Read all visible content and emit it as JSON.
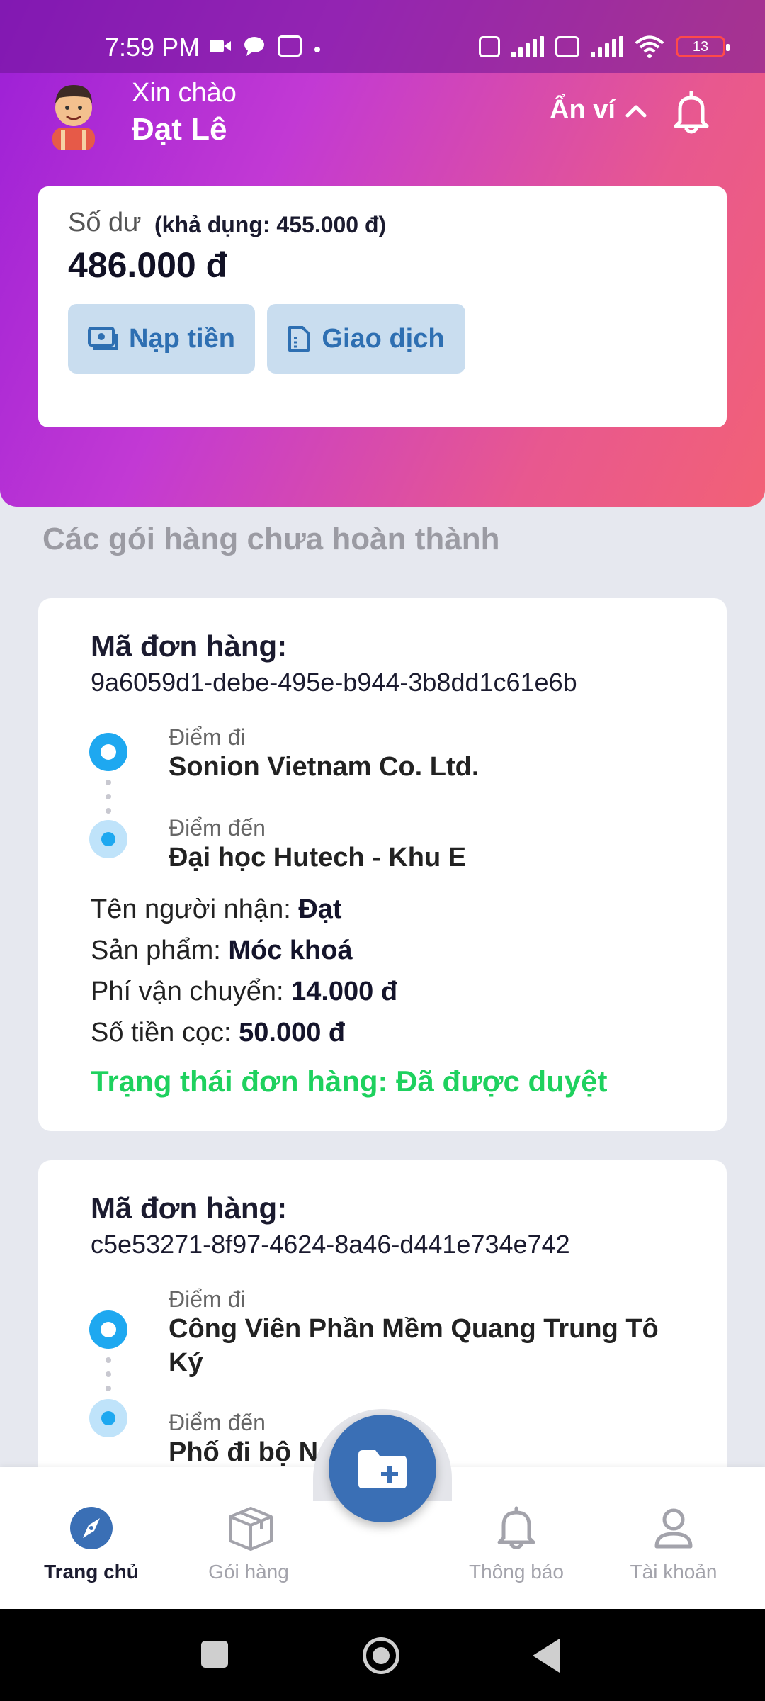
{
  "status_bar": {
    "time": "7:59 PM",
    "battery": "13",
    "icons": [
      "video-icon",
      "chat-icon",
      "screen-icon",
      "nfc-icon",
      "signal-icon",
      "volte-icon",
      "signal-icon",
      "wifi-icon",
      "battery-icon"
    ]
  },
  "header": {
    "greeting": "Xin chào",
    "username": "Đạt Lê",
    "hide_wallet_label": "Ẩn ví",
    "gradient_colors": [
      "#9b1fd6",
      "#c239d4",
      "#e8588f",
      "#f26176"
    ]
  },
  "wallet": {
    "balance_label": "Số dư",
    "available_label": "(khả dụng: 455.000 đ)",
    "balance_amount": "486.000 đ",
    "topup_label": "Nạp tiền",
    "transactions_label": "Giao dịch",
    "button_color": "#c9ddef",
    "button_text_color": "#2e6fb2"
  },
  "orders_section": {
    "title": "Các gói hàng chưa hoàn thành",
    "orders": [
      {
        "id_label": "Mã đơn hàng:",
        "id": "9a6059d1-debe-495e-b944-3b8dd1c61e6b",
        "from_label": "Điểm đi",
        "from": "Sonion Vietnam Co. Ltd.",
        "to_label": "Điểm đến",
        "to": "Đại học Hutech - Khu E",
        "receiver_label": "Tên người nhận:",
        "receiver": "Đạt",
        "product_label": "Sản phẩm:",
        "product": "Móc khoá",
        "shipping_label": "Phí vận chuyển:",
        "shipping": "14.000 đ",
        "deposit_label": "Số tiền cọc:",
        "deposit": "50.000 đ",
        "status": "Trạng thái đơn hàng: Đã được duyệt",
        "status_color": "#1ed15e"
      },
      {
        "id_label": "Mã đơn hàng:",
        "id": "c5e53271-8f97-4624-8a46-d441e734e742",
        "from_label": "Điểm đi",
        "from": "Công Viên Phần Mềm Quang Trung Tô Ký",
        "to_label": "Điểm đến",
        "to": "Phố đi bộ Ng",
        "to_tail": "ệ"
      }
    ]
  },
  "bottom_nav": {
    "items": [
      {
        "label": "Trang chủ",
        "icon": "compass-icon",
        "active": true
      },
      {
        "label": "Gói hàng",
        "icon": "package-icon",
        "active": false
      },
      {
        "label": "Thông báo",
        "icon": "bell-icon",
        "active": false
      },
      {
        "label": "Tài khoản",
        "icon": "user-icon",
        "active": false
      }
    ],
    "fab_icon": "folder-add-icon",
    "fab_color": "#3a6fb5"
  },
  "system_nav": {
    "icons": [
      "recents-icon",
      "home-icon",
      "back-icon"
    ]
  }
}
